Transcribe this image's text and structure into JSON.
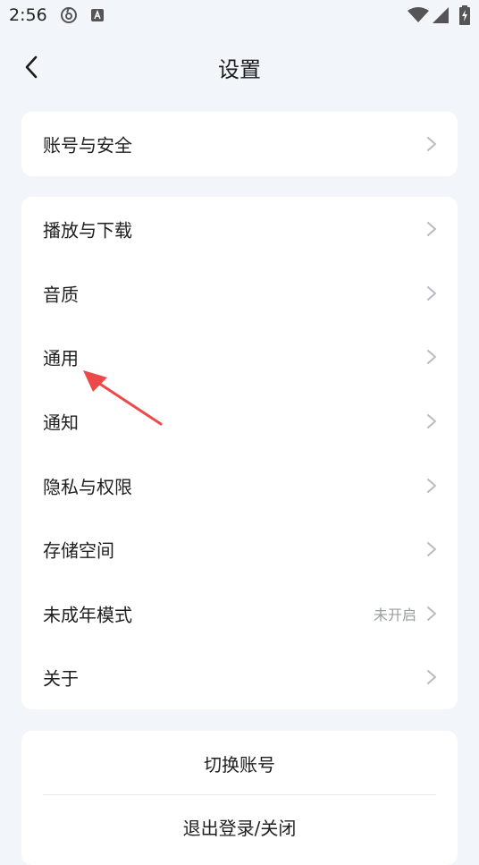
{
  "status_bar": {
    "time": "2:56"
  },
  "header": {
    "title": "设置"
  },
  "account_section": {
    "items": [
      {
        "label": "账号与安全"
      }
    ]
  },
  "settings_section": {
    "items": [
      {
        "label": "播放与下载",
        "value": ""
      },
      {
        "label": "音质",
        "value": ""
      },
      {
        "label": "通用",
        "value": ""
      },
      {
        "label": "通知",
        "value": ""
      },
      {
        "label": "隐私与权限",
        "value": ""
      },
      {
        "label": "存储空间",
        "value": ""
      },
      {
        "label": "未成年模式",
        "value": "未开启"
      },
      {
        "label": "关于",
        "value": ""
      }
    ]
  },
  "actions_section": {
    "switch_account": "切换账号",
    "logout_close": "退出登录/关闭"
  },
  "colors": {
    "background": "#f2f5fa",
    "card": "#ffffff",
    "annotation_arrow": "#ec4a4a"
  }
}
